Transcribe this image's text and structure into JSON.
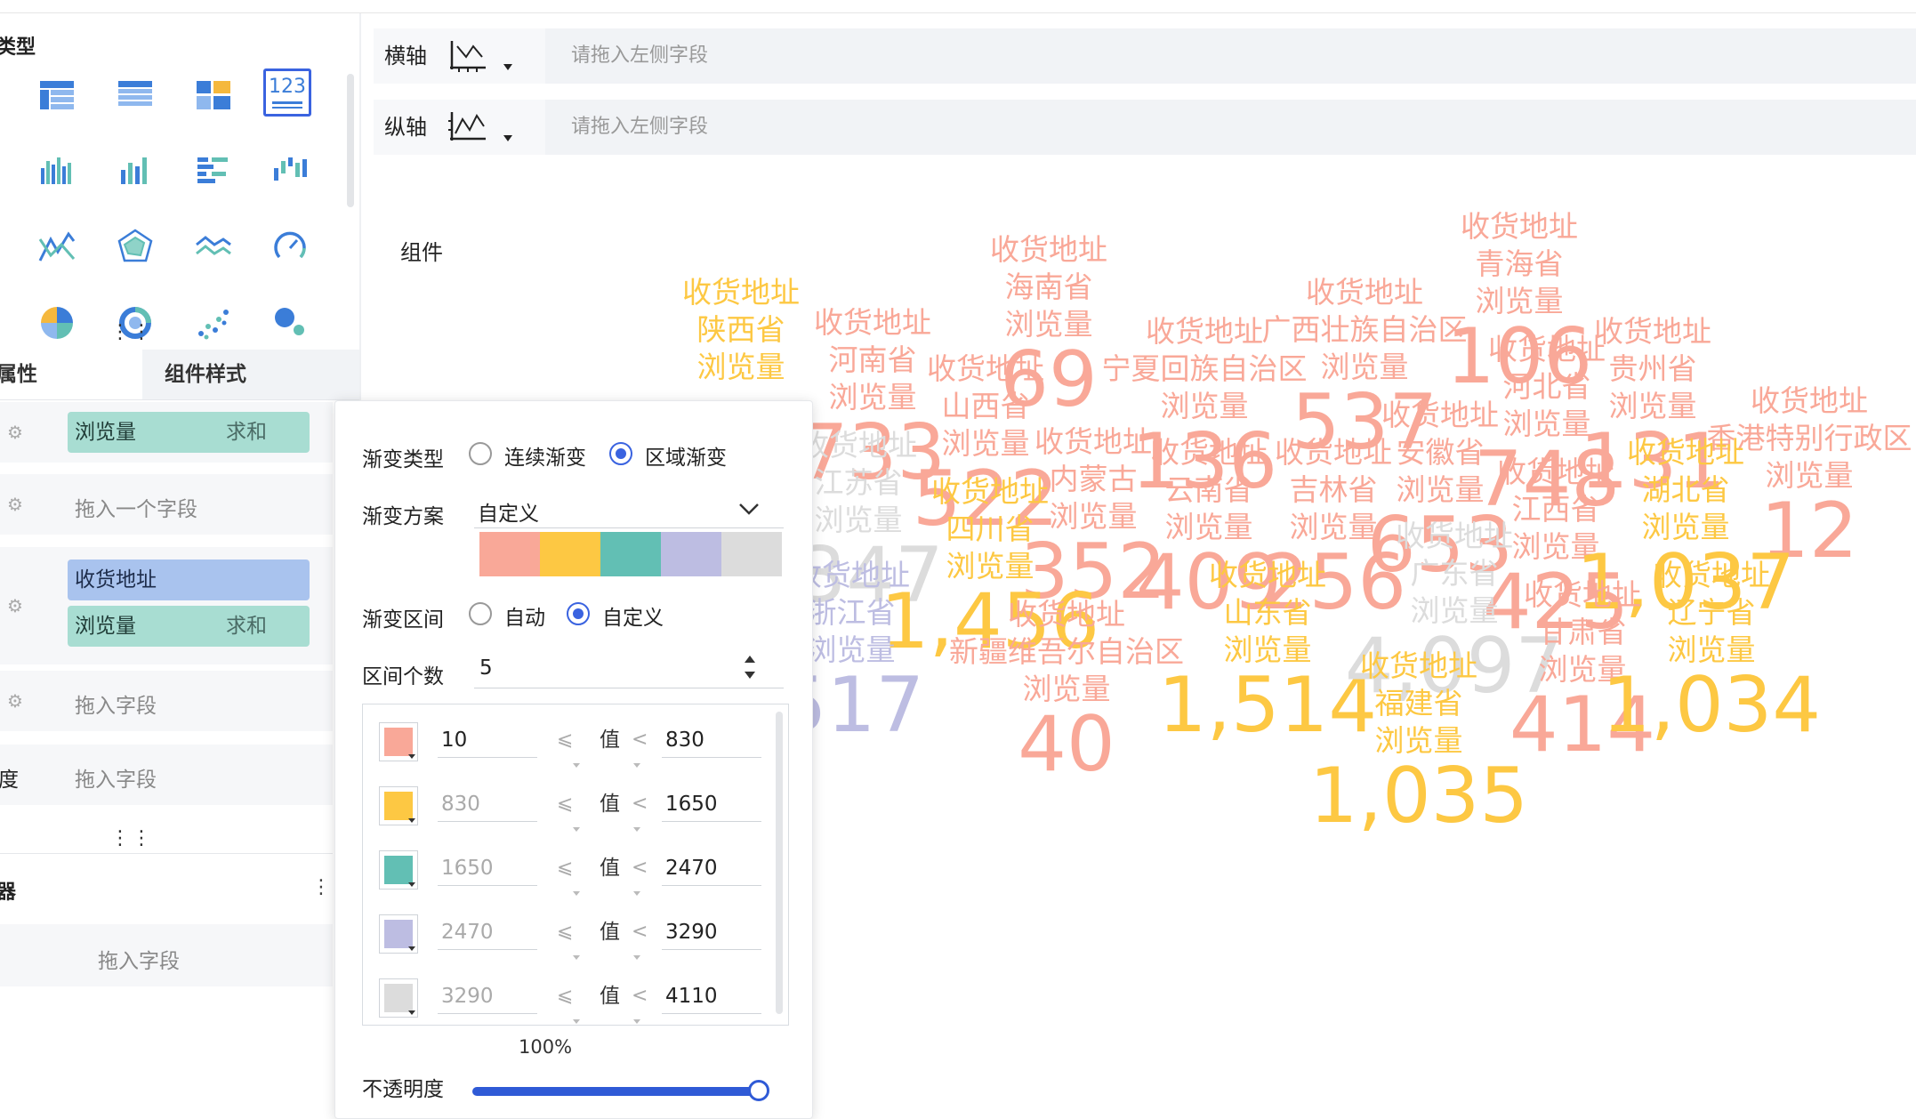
{
  "left_panel": {
    "section_title": "类型",
    "chart_types": [
      {
        "icon": "grouped-table-icon",
        "selected": false
      },
      {
        "icon": "detail-table-icon",
        "selected": false
      },
      {
        "icon": "cross-table-icon",
        "selected": false
      },
      {
        "icon": "kpi-number-icon",
        "label": "123",
        "selected": true
      },
      {
        "icon": "column-chart-icon",
        "selected": false
      },
      {
        "icon": "bar-chart-icon",
        "selected": false
      },
      {
        "icon": "horizontal-bar-icon",
        "selected": false
      },
      {
        "icon": "waterfall-chart-icon",
        "selected": false
      },
      {
        "icon": "line-chart-icon",
        "selected": false
      },
      {
        "icon": "radar-chart-icon",
        "selected": false
      },
      {
        "icon": "area-chart-icon",
        "selected": false
      },
      {
        "icon": "gauge-chart-icon",
        "selected": false
      },
      {
        "icon": "pie-chart-icon",
        "selected": false
      },
      {
        "icon": "donut-chart-icon",
        "selected": false
      },
      {
        "icon": "scatter-chart-icon",
        "selected": false
      },
      {
        "icon": "bubble-chart-icon",
        "selected": false
      }
    ],
    "tabs": {
      "properties": "属性",
      "component_style": "组件样式"
    },
    "fields": {
      "color_field": "浏览量",
      "color_agg": "求和",
      "size_placeholder": "拖入一个字段",
      "text_field_1": "收货地址",
      "text_field_2": "浏览量",
      "text_field_2_agg": "求和",
      "tooltip_placeholder": "拖入字段",
      "granularity_label": "度",
      "granularity_placeholder": "拖入字段",
      "filter_title": "器",
      "filter_placeholder": "拖入字段"
    }
  },
  "axes": {
    "x_label": "横轴",
    "y_label": "纵轴",
    "placeholder": "请拖入左侧字段"
  },
  "component_label": "组件",
  "gradient_popup": {
    "type_label": "渐变类型",
    "type_options": [
      "连续渐变",
      "区域渐变"
    ],
    "type_selected": "区域渐变",
    "scheme_label": "渐变方案",
    "scheme_value": "自定义",
    "scheme_colors": [
      "#f9a898",
      "#fdc843",
      "#62bfb4",
      "#bdbde2",
      "#dcdcdc"
    ],
    "interval_label": "渐变区间",
    "interval_options": [
      "自动",
      "自定义"
    ],
    "interval_selected": "自定义",
    "count_label": "区间个数",
    "count_value": "5",
    "ranges": [
      {
        "color": "#f9a898",
        "from": "10",
        "to": "830"
      },
      {
        "color": "#fdc843",
        "from": "830",
        "to": "1650"
      },
      {
        "color": "#62bfb4",
        "from": "1650",
        "to": "2470"
      },
      {
        "color": "#bdbde2",
        "from": "2470",
        "to": "3290"
      },
      {
        "color": "#dcdcdc",
        "from": "3290",
        "to": "4110"
      }
    ],
    "op_le": "⩽",
    "op_lt": "<",
    "value_word": "值",
    "opacity_pct": "100%",
    "opacity_label": "不透明度",
    "opacity_value": 1.0
  },
  "chart_data": {
    "type": "table",
    "field_label": "收货地址",
    "measure_label": "浏览量",
    "items": [
      {
        "province": "陕西省",
        "value": "",
        "color": "#fdc843"
      },
      {
        "province": "海南省",
        "value": "69",
        "color": "#f9a898"
      },
      {
        "province": "青海省",
        "value": "106",
        "color": "#f9a898"
      },
      {
        "province": "河南省",
        "value": "733",
        "color": "#f9a898"
      },
      {
        "province": "山西省",
        "value": "522",
        "color": "#f9a898"
      },
      {
        "province": "宁夏回族自治区",
        "value": "136",
        "color": "#f9a898"
      },
      {
        "province": "广西壮族自治区",
        "value": "537",
        "color": "#f9a898"
      },
      {
        "province": "河北省",
        "value": "748",
        "color": "#f9a898"
      },
      {
        "province": "贵州省",
        "value": "131",
        "color": "#f9a898"
      },
      {
        "province": "香港特别行政区",
        "value": "12",
        "color": "#f9a898"
      },
      {
        "province": "江苏省",
        "value": ",347",
        "color": "#dcdcdc"
      },
      {
        "province": "内蒙古",
        "value": "352",
        "color": "#f9a898"
      },
      {
        "province": "四川省",
        "value": "1,456",
        "color": "#fdc843"
      },
      {
        "province": "云南省",
        "value": "409",
        "color": "#f9a898"
      },
      {
        "province": "吉林省",
        "value": "256",
        "color": "#f9a898"
      },
      {
        "province": "安徽省",
        "value": "653",
        "color": "#f9a898"
      },
      {
        "province": "江西省",
        "value": "425",
        "color": "#f9a898"
      },
      {
        "province": "湖北省",
        "value": "1,037",
        "color": "#fdc843"
      },
      {
        "province": "浙江省",
        "value": "517",
        "color": "#bdbde2"
      },
      {
        "province": "新疆维吾尔自治区",
        "value": "40",
        "color": "#f9a898"
      },
      {
        "province": "山东省",
        "value": "1,514",
        "color": "#fdc843"
      },
      {
        "province": "广东省",
        "value": "4,097",
        "color": "#dcdcdc"
      },
      {
        "province": "甘肃省",
        "value": "414",
        "color": "#f9a898"
      },
      {
        "province": "辽宁省",
        "value": "1,034",
        "color": "#fdc843"
      },
      {
        "province": "福建省",
        "value": "1,035",
        "color": "#fdc843"
      }
    ]
  }
}
